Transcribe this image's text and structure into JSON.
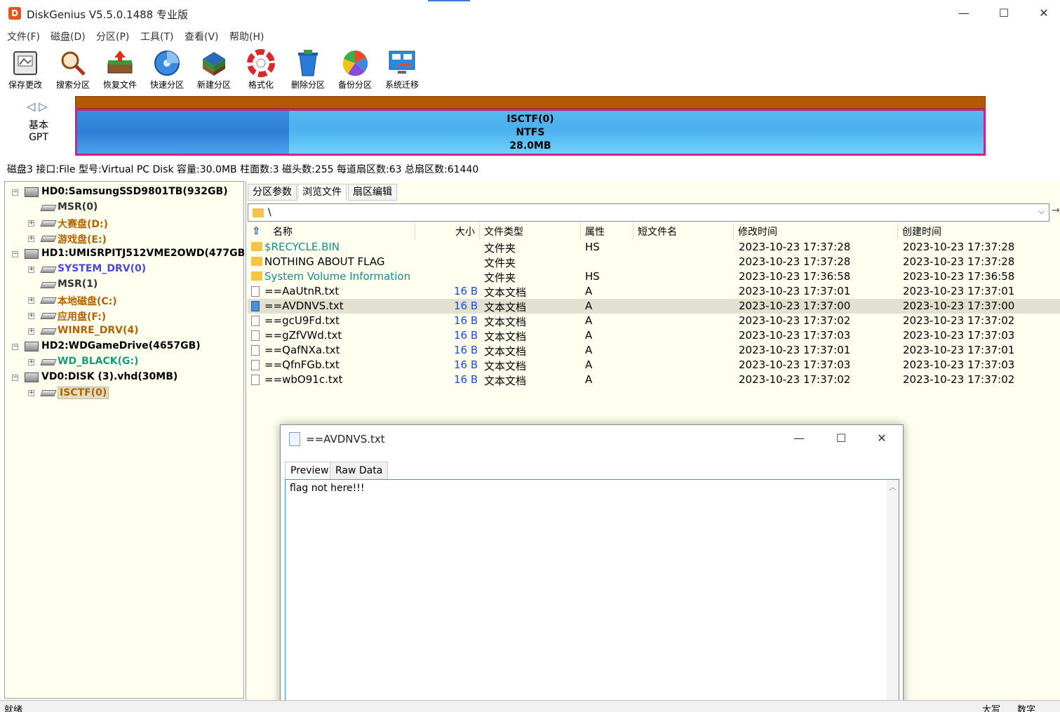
{
  "window": {
    "title": "DiskGenius V5.5.0.1488 专业版",
    "icon_text": "D",
    "minimize": "—",
    "maximize": "☐",
    "close": "✕"
  },
  "menu": [
    "文件(F)",
    "磁盘(D)",
    "分区(P)",
    "工具(T)",
    "查看(V)",
    "帮助(H)"
  ],
  "toolbar": [
    {
      "label": "保存更改",
      "icon": "save-icon"
    },
    {
      "label": "搜索分区",
      "icon": "search-icon"
    },
    {
      "label": "恢复文件",
      "icon": "restore-icon"
    },
    {
      "label": "快速分区",
      "icon": "quick-partition-icon"
    },
    {
      "label": "新建分区",
      "icon": "new-partition-icon"
    },
    {
      "label": "格式化",
      "icon": "format-icon"
    },
    {
      "label": "删除分区",
      "icon": "delete-icon"
    },
    {
      "label": "备份分区",
      "icon": "backup-icon"
    },
    {
      "label": "系统迁移",
      "icon": "migrate-icon"
    }
  ],
  "diskmap": {
    "nav": "◁ ▷",
    "type1": "基本",
    "type2": "GPT",
    "partition_name": "ISCTF(0)",
    "partition_fs": "NTFS",
    "partition_size": "28.0MB",
    "colors": {
      "frame": "#d0208c",
      "bar_top": "#b35a00"
    }
  },
  "disk_info": "磁盘3 接口:File  型号:Virtual PC Disk  容量:30.0MB  柱面数:3  磁头数:255  每道扇区数:63  总扇区数:61440",
  "tree": [
    {
      "label": "HD0:SamsungSSD9801TB(932GB)",
      "level": 0,
      "toggle": "−",
      "color": "#000000"
    },
    {
      "label": "MSR(0)",
      "level": 1,
      "toggle": "",
      "color": "#333333"
    },
    {
      "label": "大赛盘(D:)",
      "level": 1,
      "toggle": "+",
      "color": "#b36200"
    },
    {
      "label": "游戏盘(E:)",
      "level": 1,
      "toggle": "+",
      "color": "#b36200"
    },
    {
      "label": "HD1:UMISRPITJ512VME2OWD(477GB",
      "level": 0,
      "toggle": "−",
      "color": "#000000"
    },
    {
      "label": "SYSTEM_DRV(0)",
      "level": 1,
      "toggle": "+",
      "color": "#4848e0"
    },
    {
      "label": "MSR(1)",
      "level": 1,
      "toggle": "",
      "color": "#333333"
    },
    {
      "label": "本地磁盘(C:)",
      "level": 1,
      "toggle": "+",
      "color": "#b36200"
    },
    {
      "label": "应用盘(F:)",
      "level": 1,
      "toggle": "+",
      "color": "#b36200"
    },
    {
      "label": "WINRE_DRV(4)",
      "level": 1,
      "toggle": "+",
      "color": "#b36200"
    },
    {
      "label": "HD2:WDGameDrive(4657GB)",
      "level": 0,
      "toggle": "−",
      "color": "#000000"
    },
    {
      "label": "WD_BLACK(G:)",
      "level": 1,
      "toggle": "+",
      "color": "#1a9a7a"
    },
    {
      "label": "VD0:DISK (3).vhd(30MB)",
      "level": 0,
      "toggle": "−",
      "color": "#000000"
    },
    {
      "label": "ISCTF(0)",
      "level": 1,
      "toggle": "+",
      "color": "#b36200",
      "selected": true
    }
  ],
  "tabs": [
    "分区参数",
    "浏览文件",
    "扇区编辑"
  ],
  "path": "\\",
  "columns": [
    "名称",
    "大小",
    "文件类型",
    "属性",
    "短文件名",
    "修改时间",
    "创建时间"
  ],
  "files": [
    {
      "name": "$RECYCLE.BIN",
      "size": "",
      "type": "文件夹",
      "attr": "HS",
      "short": "",
      "modified": "2023-10-23 17:37:28",
      "created": "2023-10-23 17:37:28",
      "kind": "folder",
      "color": "#1a8a8a"
    },
    {
      "name": "NOTHING ABOUT FLAG",
      "size": "",
      "type": "文件夹",
      "attr": "",
      "short": "",
      "modified": "2023-10-23 17:37:28",
      "created": "2023-10-23 17:37:28",
      "kind": "folder",
      "color": "#000000"
    },
    {
      "name": "System Volume Information",
      "size": "",
      "type": "文件夹",
      "attr": "HS",
      "short": "",
      "modified": "2023-10-23 17:36:58",
      "created": "2023-10-23 17:36:58",
      "kind": "folder",
      "color": "#1a8a8a"
    },
    {
      "name": "==AaUtnR.txt",
      "size": "16 B",
      "type": "文本文档",
      "attr": "A",
      "short": "",
      "modified": "2023-10-23 17:37:01",
      "created": "2023-10-23 17:37:01",
      "kind": "file",
      "color": "#000000"
    },
    {
      "name": "==AVDNVS.txt",
      "size": "16 B",
      "type": "文本文档",
      "attr": "A",
      "short": "",
      "modified": "2023-10-23 17:37:00",
      "created": "2023-10-23 17:37:00",
      "kind": "file",
      "color": "#000000",
      "selected": true
    },
    {
      "name": "==gcU9Fd.txt",
      "size": "16 B",
      "type": "文本文档",
      "attr": "A",
      "short": "",
      "modified": "2023-10-23 17:37:02",
      "created": "2023-10-23 17:37:02",
      "kind": "file",
      "color": "#000000"
    },
    {
      "name": "==gZfVWd.txt",
      "size": "16 B",
      "type": "文本文档",
      "attr": "A",
      "short": "",
      "modified": "2023-10-23 17:37:03",
      "created": "2023-10-23 17:37:03",
      "kind": "file",
      "color": "#000000"
    },
    {
      "name": "==QafNXa.txt",
      "size": "16 B",
      "type": "文本文档",
      "attr": "A",
      "short": "",
      "modified": "2023-10-23 17:37:01",
      "created": "2023-10-23 17:37:01",
      "kind": "file",
      "color": "#000000"
    },
    {
      "name": "==QfnFGb.txt",
      "size": "16 B",
      "type": "文本文档",
      "attr": "A",
      "short": "",
      "modified": "2023-10-23 17:37:03",
      "created": "2023-10-23 17:37:03",
      "kind": "file",
      "color": "#000000"
    },
    {
      "name": "==wbO91c.txt",
      "size": "16 B",
      "type": "文本文档",
      "attr": "A",
      "short": "",
      "modified": "2023-10-23 17:37:02",
      "created": "2023-10-23 17:37:02",
      "kind": "file",
      "color": "#000000"
    }
  ],
  "popup": {
    "title": "==AVDNVS.txt",
    "tabs": [
      "Preview",
      "Raw Data"
    ],
    "content": "flag not here!!!",
    "minimize": "—",
    "maximize": "☐",
    "close": "✕"
  },
  "status": {
    "left": "就绪",
    "caps": "大写",
    "num": "数字"
  }
}
